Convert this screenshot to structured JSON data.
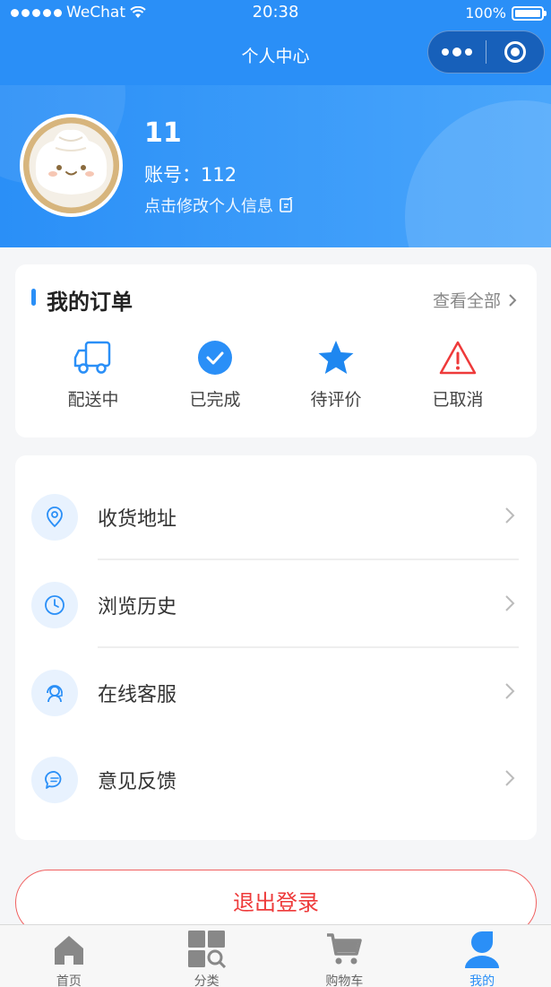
{
  "status_bar": {
    "carrier": "WeChat",
    "time": "20:38",
    "battery": "100%"
  },
  "nav": {
    "title": "个人中心"
  },
  "profile": {
    "name": "11",
    "account": "账号：112",
    "edit_label": "点击修改个人信息"
  },
  "orders": {
    "title": "我的订单",
    "view_all": "查看全部",
    "items": [
      {
        "label": "配送中",
        "icon": "truck-icon"
      },
      {
        "label": "已完成",
        "icon": "check-circle-icon"
      },
      {
        "label": "待评价",
        "icon": "star-icon"
      },
      {
        "label": "已取消",
        "icon": "warning-icon"
      }
    ]
  },
  "menu": {
    "items": [
      {
        "label": "收货地址",
        "icon": "location-icon"
      },
      {
        "label": "浏览历史",
        "icon": "clock-icon"
      },
      {
        "label": "在线客服",
        "icon": "headset-icon"
      },
      {
        "label": "意见反馈",
        "icon": "message-icon"
      }
    ]
  },
  "logout_label": "退出登录",
  "tabbar": {
    "items": [
      {
        "label": "首页",
        "icon": "home-icon"
      },
      {
        "label": "分类",
        "icon": "category-icon"
      },
      {
        "label": "购物车",
        "icon": "cart-icon"
      },
      {
        "label": "我的",
        "icon": "user-icon"
      }
    ],
    "active_index": 3
  },
  "colors": {
    "primary": "#2a8ff7",
    "danger": "#ee3a3a",
    "star": "#1e87f0"
  }
}
